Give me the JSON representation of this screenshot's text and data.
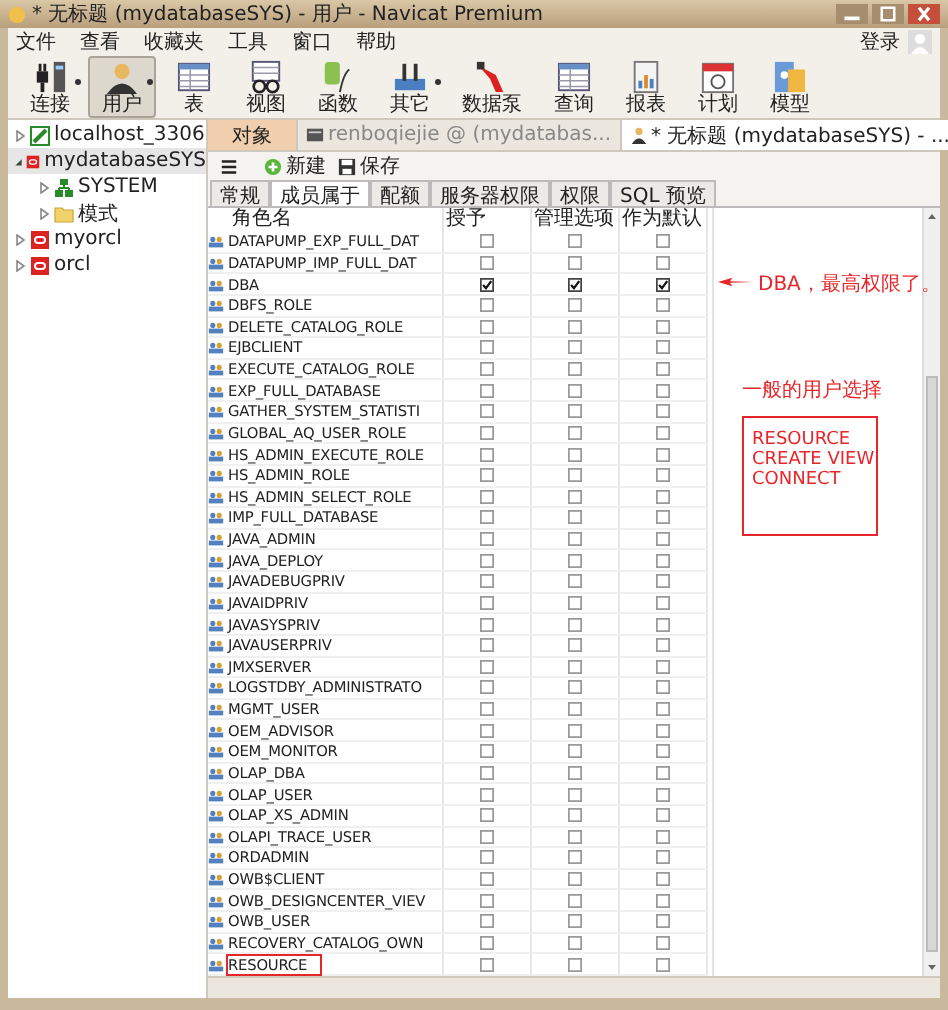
{
  "window": {
    "title": "* 无标题 (mydatabaseSYS) - 用户 - Navicat Premium"
  },
  "menu": [
    "文件",
    "查看",
    "收藏夹",
    "工具",
    "窗口",
    "帮助"
  ],
  "login": "登录",
  "toolbar": [
    {
      "kind": "plug",
      "label": "连接",
      "selected": false,
      "dropdown": true
    },
    {
      "kind": "user",
      "label": "用户",
      "selected": true,
      "dropdown": true
    },
    {
      "kind": "table",
      "label": "表",
      "selected": false,
      "dropdown": false
    },
    {
      "kind": "view",
      "label": "视图",
      "selected": false,
      "dropdown": false
    },
    {
      "kind": "function",
      "label": "函数",
      "selected": false,
      "dropdown": false
    },
    {
      "kind": "other",
      "label": "其它",
      "selected": false,
      "dropdown": true
    },
    {
      "kind": "pump",
      "label": "数据泵",
      "selected": false,
      "dropdown": false
    },
    {
      "kind": "query",
      "label": "查询",
      "selected": false,
      "dropdown": false
    },
    {
      "kind": "report",
      "label": "报表",
      "selected": false,
      "dropdown": false
    },
    {
      "kind": "schedule",
      "label": "计划",
      "selected": false,
      "dropdown": false
    },
    {
      "kind": "model",
      "label": "模型",
      "selected": false,
      "dropdown": false
    }
  ],
  "connections": [
    {
      "kind": "mysql",
      "label": "localhost_3306",
      "expanded": false,
      "selected": false
    },
    {
      "kind": "oracle",
      "label": "mydatabaseSYS",
      "expanded": true,
      "selected": true,
      "children": [
        {
          "kind": "schema",
          "label": "SYSTEM",
          "expanded": false,
          "selected": false
        },
        {
          "kind": "folder",
          "label": "模式",
          "expanded": false,
          "selected": false
        }
      ]
    },
    {
      "kind": "oracle",
      "label": "myorcl",
      "expanded": false,
      "selected": false
    },
    {
      "kind": "oracle",
      "label": "orcl",
      "expanded": false,
      "selected": false
    }
  ],
  "tabs": [
    {
      "kind": "objects",
      "label": "对象",
      "selected": false
    },
    {
      "kind": "table",
      "label": "renboqiejie @ (mydatabas...",
      "selected": false
    },
    {
      "kind": "user",
      "label": "* 无标题 (mydatabaseSYS) - ...",
      "selected": true
    }
  ],
  "actions": [
    {
      "kind": "new",
      "label": "新建"
    },
    {
      "kind": "save",
      "label": "保存"
    }
  ],
  "subtabs": [
    {
      "label": "常规",
      "selected": false
    },
    {
      "label": "成员属于",
      "selected": true
    },
    {
      "label": "配额",
      "selected": false
    },
    {
      "label": "服务器权限",
      "selected": false
    },
    {
      "label": "权限",
      "selected": false
    },
    {
      "label": "SQL 预览",
      "selected": false
    }
  ],
  "table": {
    "columns": [
      "角色名",
      "授予",
      "管理选项",
      "作为默认"
    ],
    "rows": [
      {
        "name": "DATAPUMP_EXP_FULL_DAT",
        "granted": false,
        "admin_option": false,
        "default": false,
        "marked": false
      },
      {
        "name": "DATAPUMP_IMP_FULL_DAT",
        "granted": false,
        "admin_option": false,
        "default": false,
        "marked": false
      },
      {
        "name": "DBA",
        "granted": true,
        "admin_option": true,
        "default": true,
        "marked": false
      },
      {
        "name": "DBFS_ROLE",
        "granted": false,
        "admin_option": false,
        "default": false,
        "marked": false
      },
      {
        "name": "DELETE_CATALOG_ROLE",
        "granted": false,
        "admin_option": false,
        "default": false,
        "marked": false
      },
      {
        "name": "EJBCLIENT",
        "granted": false,
        "admin_option": false,
        "default": false,
        "marked": false
      },
      {
        "name": "EXECUTE_CATALOG_ROLE",
        "granted": false,
        "admin_option": false,
        "default": false,
        "marked": false
      },
      {
        "name": "EXP_FULL_DATABASE",
        "granted": false,
        "admin_option": false,
        "default": false,
        "marked": false
      },
      {
        "name": "GATHER_SYSTEM_STATISTI",
        "granted": false,
        "admin_option": false,
        "default": false,
        "marked": false
      },
      {
        "name": "GLOBAL_AQ_USER_ROLE",
        "granted": false,
        "admin_option": false,
        "default": false,
        "marked": false
      },
      {
        "name": "HS_ADMIN_EXECUTE_ROLE",
        "granted": false,
        "admin_option": false,
        "default": false,
        "marked": false
      },
      {
        "name": "HS_ADMIN_ROLE",
        "granted": false,
        "admin_option": false,
        "default": false,
        "marked": false
      },
      {
        "name": "HS_ADMIN_SELECT_ROLE",
        "granted": false,
        "admin_option": false,
        "default": false,
        "marked": false
      },
      {
        "name": "IMP_FULL_DATABASE",
        "granted": false,
        "admin_option": false,
        "default": false,
        "marked": false
      },
      {
        "name": "JAVA_ADMIN",
        "granted": false,
        "admin_option": false,
        "default": false,
        "marked": false
      },
      {
        "name": "JAVA_DEPLOY",
        "granted": false,
        "admin_option": false,
        "default": false,
        "marked": false
      },
      {
        "name": "JAVADEBUGPRIV",
        "granted": false,
        "admin_option": false,
        "default": false,
        "marked": false
      },
      {
        "name": "JAVAIDPRIV",
        "granted": false,
        "admin_option": false,
        "default": false,
        "marked": false
      },
      {
        "name": "JAVASYSPRIV",
        "granted": false,
        "admin_option": false,
        "default": false,
        "marked": false
      },
      {
        "name": "JAVAUSERPRIV",
        "granted": false,
        "admin_option": false,
        "default": false,
        "marked": false
      },
      {
        "name": "JMXSERVER",
        "granted": false,
        "admin_option": false,
        "default": false,
        "marked": false
      },
      {
        "name": "LOGSTDBY_ADMINISTRATO",
        "granted": false,
        "admin_option": false,
        "default": false,
        "marked": false
      },
      {
        "name": "MGMT_USER",
        "granted": false,
        "admin_option": false,
        "default": false,
        "marked": false
      },
      {
        "name": "OEM_ADVISOR",
        "granted": false,
        "admin_option": false,
        "default": false,
        "marked": false
      },
      {
        "name": "OEM_MONITOR",
        "granted": false,
        "admin_option": false,
        "default": false,
        "marked": false
      },
      {
        "name": "OLAP_DBA",
        "granted": false,
        "admin_option": false,
        "default": false,
        "marked": false
      },
      {
        "name": "OLAP_USER",
        "granted": false,
        "admin_option": false,
        "default": false,
        "marked": false
      },
      {
        "name": "OLAP_XS_ADMIN",
        "granted": false,
        "admin_option": false,
        "default": false,
        "marked": false
      },
      {
        "name": "OLAPI_TRACE_USER",
        "granted": false,
        "admin_option": false,
        "default": false,
        "marked": false
      },
      {
        "name": "ORDADMIN",
        "granted": false,
        "admin_option": false,
        "default": false,
        "marked": false
      },
      {
        "name": "OWB$CLIENT",
        "granted": false,
        "admin_option": false,
        "default": false,
        "marked": false
      },
      {
        "name": "OWB_DESIGNCENTER_VIEV",
        "granted": false,
        "admin_option": false,
        "default": false,
        "marked": false
      },
      {
        "name": "OWB_USER",
        "granted": false,
        "admin_option": false,
        "default": false,
        "marked": false
      },
      {
        "name": "RECOVERY_CATALOG_OWN",
        "granted": false,
        "admin_option": false,
        "default": false,
        "marked": false
      },
      {
        "name": "RESOURCE",
        "granted": false,
        "admin_option": false,
        "default": false,
        "marked": true
      }
    ]
  },
  "annotations": {
    "arrow_note": "DBA，最高权限了。",
    "note": "一般的用户选择",
    "box_lines": [
      "RESOURCE",
      "CREATE VIEW",
      "CONNECT"
    ]
  }
}
